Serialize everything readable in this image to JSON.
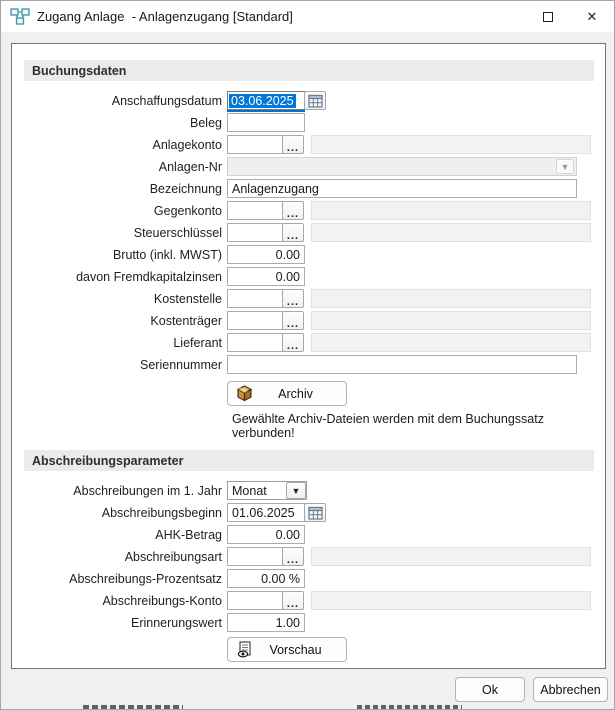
{
  "window": {
    "title": "Zugang Anlage  - Anlagenzugang [Standard]"
  },
  "icons": {
    "ellipsis": "...",
    "dropdown_arrow": "▼",
    "close": "✕"
  },
  "sections": [
    {
      "title": "Buchungsdaten"
    },
    {
      "title": "Abschreibungsparameter"
    }
  ],
  "fields": {
    "anschaffungsdatum": {
      "label": "Anschaffungsdatum",
      "value": "03.06.2025"
    },
    "beleg": {
      "label": "Beleg",
      "value": ""
    },
    "anlagekonto": {
      "label": "Anlagekonto",
      "value": ""
    },
    "anlagen_nr": {
      "label": "Anlagen-Nr",
      "value": ""
    },
    "bezeichnung": {
      "label": "Bezeichnung",
      "value": "Anlagenzugang"
    },
    "gegenkonto": {
      "label": "Gegenkonto",
      "value": ""
    },
    "steuerschluessel": {
      "label": "Steuerschlüssel",
      "value": ""
    },
    "brutto": {
      "label": "Brutto (inkl. MWST)",
      "value": "0.00"
    },
    "fremdkapitalzinsen": {
      "label": "davon Fremdkapitalzinsen",
      "value": "0.00"
    },
    "kostenstelle": {
      "label": "Kostenstelle",
      "value": ""
    },
    "kostentraeger": {
      "label": "Kostenträger",
      "value": ""
    },
    "lieferant": {
      "label": "Lieferant",
      "value": ""
    },
    "seriennummer": {
      "label": "Seriennummer",
      "value": ""
    },
    "abschreibungen_1jahr": {
      "label": "Abschreibungen im 1. Jahr",
      "value": "Monat"
    },
    "abschreibungsbeginn": {
      "label": "Abschreibungsbeginn",
      "value": "01.06.2025"
    },
    "ahk_betrag": {
      "label": "AHK-Betrag",
      "value": "0.00"
    },
    "abschreibungsart": {
      "label": "Abschreibungsart",
      "value": ""
    },
    "abschreibungs_prozentsatz": {
      "label": "Abschreibungs-Prozentsatz",
      "value": "0.00 %"
    },
    "abschreibungs_konto": {
      "label": "Abschreibungs-Konto",
      "value": ""
    },
    "erinnerungswert": {
      "label": "Erinnerungswert",
      "value": "1.00"
    }
  },
  "buttons": {
    "archiv": "Archiv",
    "vorschau": "Vorschau",
    "ok": "Ok",
    "abbrechen": "Abbrechen"
  },
  "hint": "Gewählte Archiv-Dateien werden mit dem Buchungssatz verbunden!",
  "colors": {
    "selection_blue": "#0078d7",
    "focus_underline": "#0b6fd0",
    "title_icon_teal": "#3f95a0",
    "archiv_gold": "#d29a3a",
    "section_strip": "#ebebeb",
    "dialog_background": "#f0f0f0"
  }
}
